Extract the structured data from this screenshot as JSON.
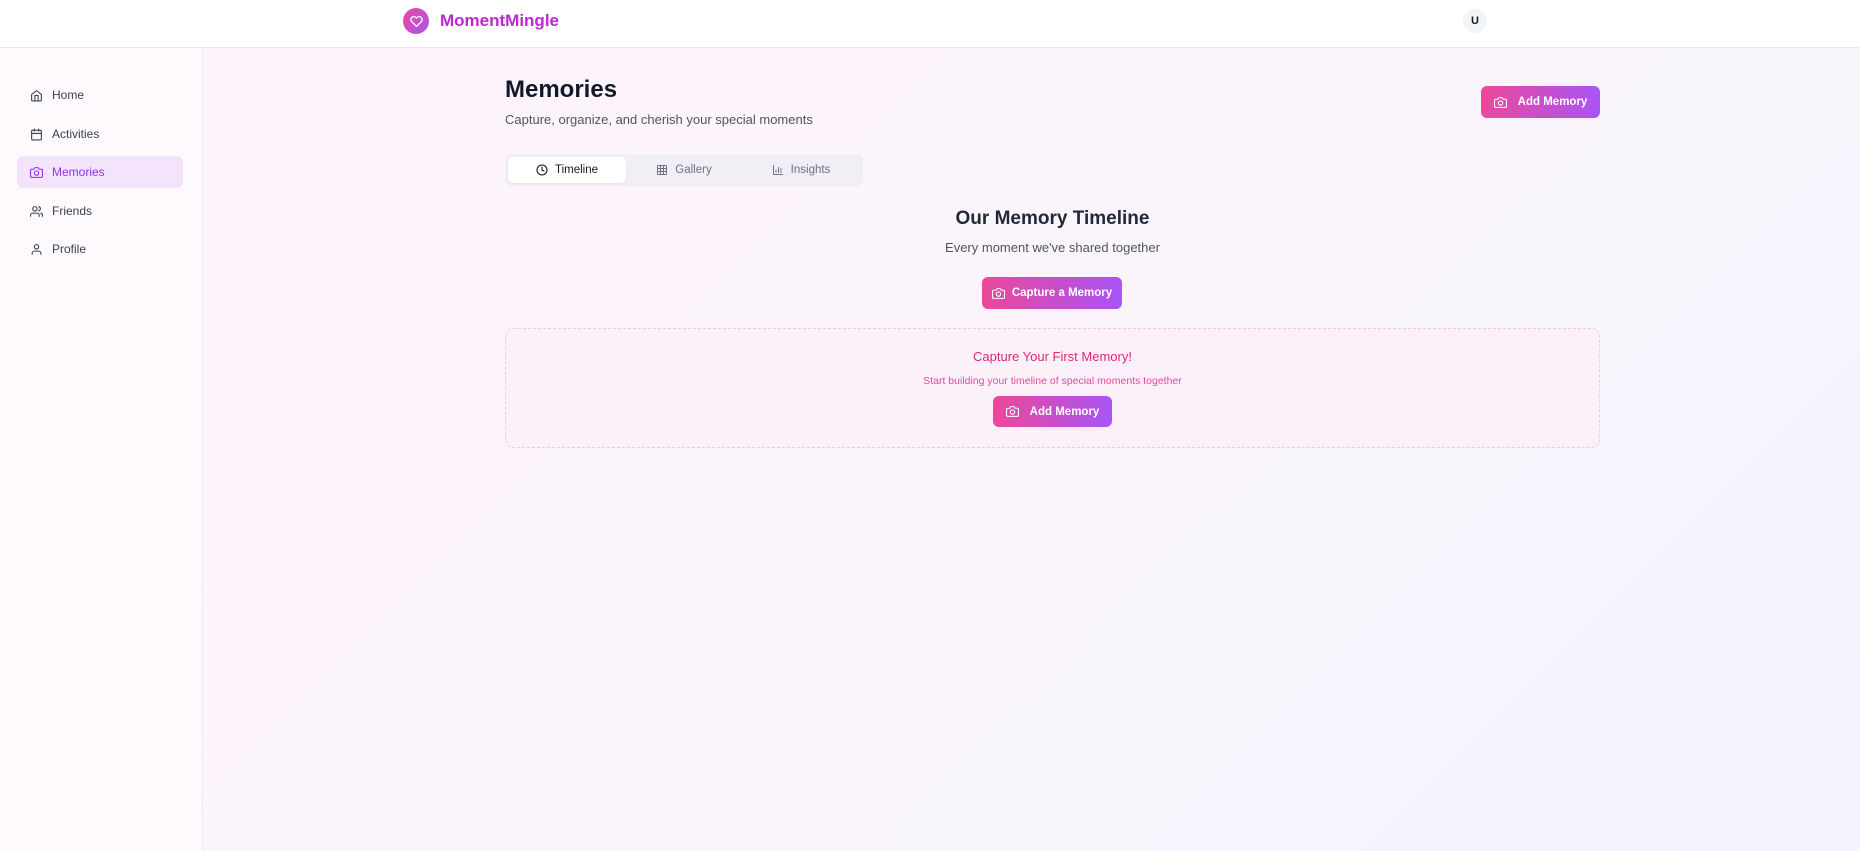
{
  "header": {
    "brand": "MomentMingle",
    "avatar_initial": "U"
  },
  "sidebar": {
    "items": [
      {
        "label": "Home",
        "icon": "home-icon",
        "active": false
      },
      {
        "label": "Activities",
        "icon": "calendar-icon",
        "active": false
      },
      {
        "label": "Memories",
        "icon": "camera-icon",
        "active": true
      },
      {
        "label": "Friends",
        "icon": "users-icon",
        "active": false
      },
      {
        "label": "Profile",
        "icon": "user-icon",
        "active": false
      }
    ]
  },
  "main": {
    "title": "Memories",
    "subtitle": "Capture, organize, and cherish your special moments",
    "add_memory_label": "Add Memory",
    "tabs": [
      {
        "label": "Timeline",
        "icon": "clock-icon",
        "active": true
      },
      {
        "label": "Gallery",
        "icon": "grid-icon",
        "active": false
      },
      {
        "label": "Insights",
        "icon": "bar-chart-icon",
        "active": false
      }
    ],
    "timeline": {
      "title": "Our Memory Timeline",
      "subtitle": "Every moment we've shared together",
      "capture_label": "Capture a Memory"
    },
    "empty_state": {
      "title": "Capture Your First Memory!",
      "subtitle": "Start building your timeline of special moments together",
      "button_label": "Add Memory"
    }
  },
  "colors": {
    "brand_pink": "#ec4899",
    "brand_purple": "#a855f7",
    "brand_text": "#c026d3",
    "active_nav_bg": "#f3e3fb",
    "active_nav_text": "#9333ea"
  }
}
